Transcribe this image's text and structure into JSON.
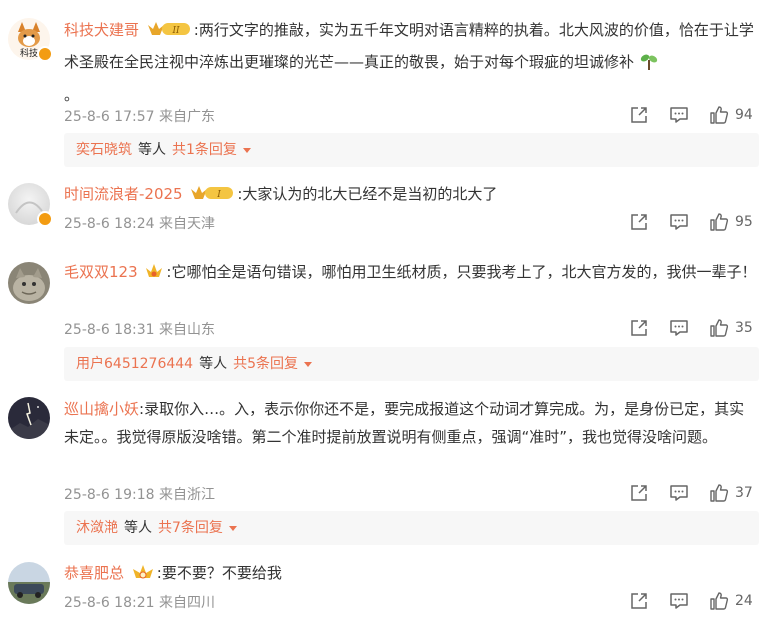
{
  "comments": [
    {
      "username": "科技犬建哥",
      "text": ":两行文字的推敲，实为五千年文明对语言精粹的执着。北大风波的价值，恰在于让学术圣殿在全民注视中淬炼出更璀璨的光芒——真正的敬畏，始于对每个瑕疵的坦诚修补",
      "text_end": "。",
      "meta": "25-8-6 17:57 来自广东",
      "likes": "94",
      "replies": {
        "who": "奕石晓筑",
        "etc": "等人",
        "more": "共1条回复"
      }
    },
    {
      "username": "时间流浪者-2025",
      "text": ":大家认为的北大已经不是当初的北大了",
      "meta": "25-8-6 18:24 来自天津",
      "likes": "95"
    },
    {
      "username": "毛双双123",
      "text": ":它哪怕全是语句错误，哪怕用卫生纸材质，只要我考上了，北大官方发的，我供一辈子！",
      "meta": "25-8-6 18:31 来自山东",
      "likes": "35",
      "replies": {
        "who": "用户6451276444",
        "etc": "等人",
        "more": "共5条回复"
      }
    },
    {
      "username": "巡山擒小妖",
      "text": ":录取你入…。入，表示你你还不是，要完成报道这个动词才算完成。为，是身份已定，其实未定。。我觉得原版没啥错。第二个准时提前放置说明有侧重点，强调“准时”，我也觉得没啥问题。",
      "meta": "25-8-6 19:18 来自浙江",
      "likes": "37",
      "replies": {
        "who": "沐潋滟",
        "etc": "等人",
        "more": "共7条回复"
      }
    },
    {
      "username": "恭喜肥总",
      "text": ":要不要？不要给我",
      "meta": "25-8-6 18:21 来自四川",
      "likes": "24"
    }
  ],
  "colors": {
    "accent": "#eb7350",
    "meta": "#939393",
    "badge": "#f39c12"
  }
}
